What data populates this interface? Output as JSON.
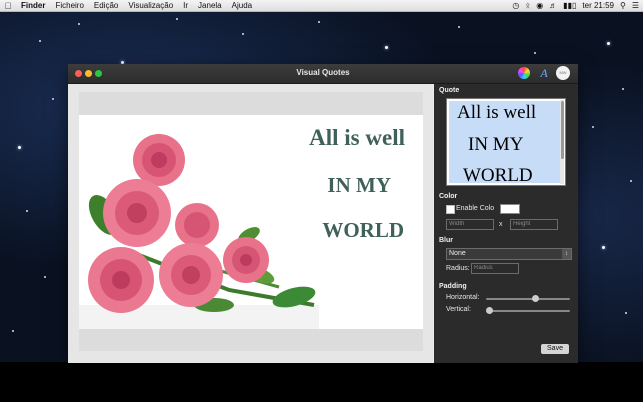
{
  "menubar": {
    "app_name": "Finder",
    "items": [
      "Ficheiro",
      "Edição",
      "Visualização",
      "Ir",
      "Janela",
      "Ajuda"
    ],
    "clock": "ter 21:59"
  },
  "window": {
    "title": "Visual Quotes"
  },
  "canvas": {
    "quote_lines": [
      "All is well",
      "IN MY",
      "WORLD"
    ]
  },
  "inspector": {
    "quote_section": "Quote",
    "preview_lines": [
      "All is well",
      "IN MY",
      "WORLD"
    ],
    "color_section": "Color",
    "enable_color_label": "Enable Colo",
    "enable_color_checked": false,
    "width_placeholder": "Width",
    "x_label": "x",
    "height_placeholder": "Height",
    "blur_section": "Blur",
    "blur_selected": "None",
    "radius_label": "Radius:",
    "radius_placeholder": "Radius",
    "padding_section": "Padding",
    "horizontal_label": "Horizontal:",
    "horizontal_value": 0.6,
    "vertical_label": "Vertical:",
    "vertical_value": 0.0,
    "save_label": "Save"
  },
  "colors": {
    "quote_text": "#40605a",
    "preview_bg": "#c7dcf6",
    "inspector_bg": "#2b2b2b"
  }
}
